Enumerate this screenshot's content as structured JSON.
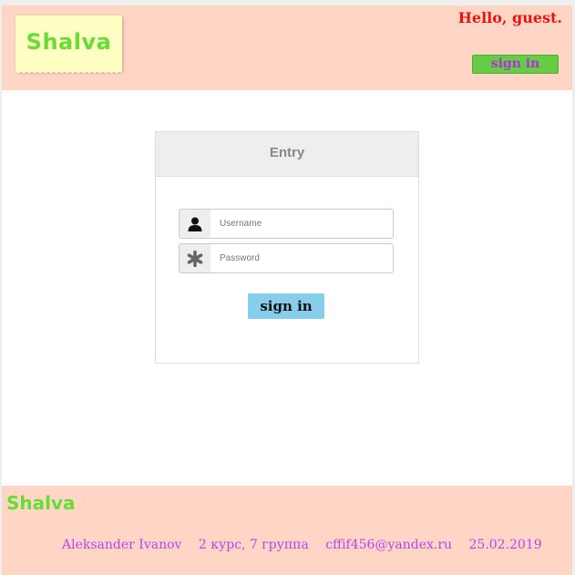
{
  "header": {
    "logo": "Shalva",
    "greeting": "Hello, guest.",
    "signin_label": "sign in"
  },
  "login": {
    "title": "Entry",
    "username": {
      "placeholder": "Username",
      "value": "",
      "icon": "user-icon"
    },
    "password": {
      "placeholder": "Password",
      "value": "",
      "icon": "asterisk-icon"
    },
    "submit_label": "sign in"
  },
  "footer": {
    "logo": "Shalva",
    "author": "Aleksander Ivanov",
    "group": "2 курс, 7 группа",
    "email": "cffif456@yandex.ru",
    "date": "25.02.2019"
  },
  "colors": {
    "header_bg": "#ffd5c5",
    "logo_green": "#66dd33",
    "greeting_red": "#ee1111",
    "signin_green": "#66cc44",
    "footer_text_purple": "#bb44ee",
    "submit_blue": "#87ceeb"
  }
}
